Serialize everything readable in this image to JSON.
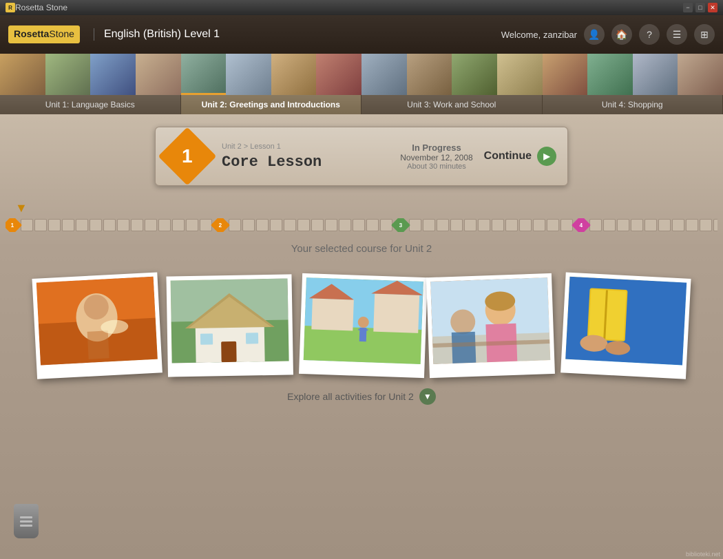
{
  "titlebar": {
    "app_name": "Rosetta Stone",
    "min_label": "−",
    "max_label": "□",
    "close_label": "✕"
  },
  "topbar": {
    "logo_rosetta": "Rosetta",
    "logo_stone": "Stone",
    "course_title": "English (British) Level 1",
    "welcome_text": "Welcome, zanzibar",
    "user_icon": "👤",
    "home_icon": "🏠",
    "help_icon": "?",
    "menu_icon": "☰",
    "settings_icon": "⚙"
  },
  "unit_tabs": [
    {
      "label": "Unit 1: Language Basics",
      "active": false
    },
    {
      "label": "Unit 2: Greetings and Introductions",
      "active": true
    },
    {
      "label": "Unit 3: Work and School",
      "active": false
    },
    {
      "label": "Unit 4: Shopping",
      "active": false
    }
  ],
  "core_lesson": {
    "lesson_path": "Unit 2 > Lesson 1",
    "title": "Core Lesson",
    "status": "In Progress",
    "date": "November 12, 2008",
    "duration": "About 30 minutes",
    "continue_label": "Continue",
    "diamond_number": "1"
  },
  "progress": {
    "dropdown_arrow": "▼",
    "selected_course_text": "Your selected course for Unit 2"
  },
  "explore_bar": {
    "label": "Explore all activities for Unit 2",
    "dropdown_icon": "▼"
  },
  "photos": [
    {
      "alt": "Child with flashlight in tent",
      "class": "gp1"
    },
    {
      "alt": "Thatched roof cottage",
      "class": "gp2"
    },
    {
      "alt": "Child on lawn",
      "class": "gp3"
    },
    {
      "alt": "Woman with students",
      "class": "gp4"
    },
    {
      "alt": "Yellow book and blue door",
      "class": "gp5"
    }
  ],
  "watermark": "biblioteki.net"
}
